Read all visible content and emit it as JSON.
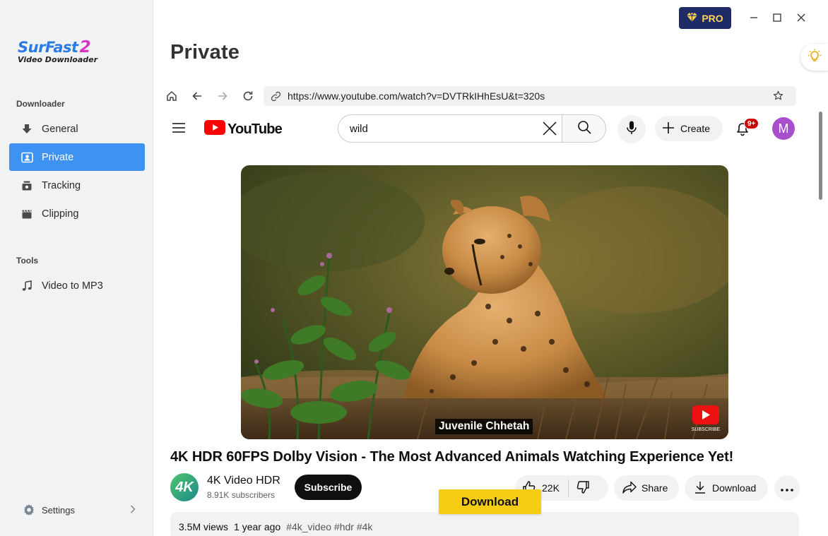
{
  "app": {
    "logo_main": "SurFast",
    "logo_num": "2",
    "logo_sub": "Video Downloader"
  },
  "sidebar": {
    "sections": [
      {
        "title": "Downloader"
      },
      {
        "title": "Tools"
      }
    ],
    "items": [
      {
        "label": "General",
        "icon": "download-icon"
      },
      {
        "label": "Private",
        "icon": "private-icon",
        "active": true
      },
      {
        "label": "Tracking",
        "icon": "tracking-icon"
      },
      {
        "label": "Clipping",
        "icon": "clipping-icon"
      },
      {
        "label": "Video to MP3",
        "icon": "music-note-icon"
      }
    ],
    "settings_label": "Settings"
  },
  "header": {
    "pro_label": "PRO",
    "page_title": "Private"
  },
  "browser": {
    "url": "https://www.youtube.com/watch?v=DVTRkIHhEsU&t=320s"
  },
  "youtube": {
    "logo_text": "YouTube",
    "search_value": "wild",
    "create_label": "Create",
    "notification_badge": "9+",
    "avatar_letter": "M",
    "video_caption": "Juvenile Chhetah",
    "video_title": "4K HDR 60FPS Dolby Vision - The Most Advanced Animals Watching Experience Yet!",
    "channel_avatar_text": "4K",
    "channel_name": "4K Video HDR",
    "channel_subs": "8.91K subscribers",
    "subscribe_label": "Subscribe",
    "like_count": "22K",
    "share_label": "Share",
    "download_label": "Download",
    "views": "3.5M views",
    "age": "1 year ago",
    "tags": "#4k_video #hdr #4k"
  },
  "overlay": {
    "download_button": "Download"
  },
  "colors": {
    "accent": "#3d92f2",
    "pro_bg": "#1e2b66",
    "download_yellow": "#f6cd15",
    "youtube_red": "#ff0000"
  }
}
